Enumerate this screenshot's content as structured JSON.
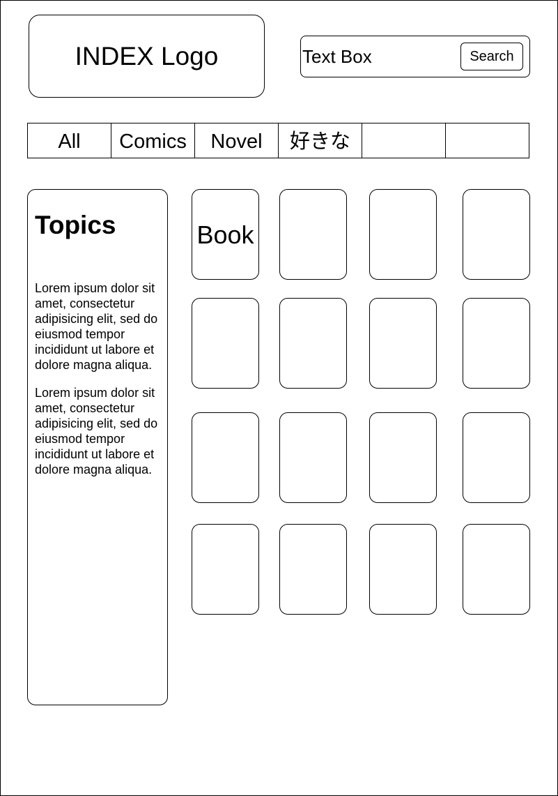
{
  "header": {
    "logo_text": "INDEX Logo",
    "search": {
      "value": "Text Box",
      "button_label": "Search"
    }
  },
  "tabs": [
    "All",
    "Comics",
    "Novel",
    "好きな",
    "",
    ""
  ],
  "sidebar": {
    "title": "Topics",
    "paragraphs": [
      "Lorem ipsum dolor sit amet, consectetur adipisicing elit, sed do eiusmod tempor incididunt ut labore et dolore magna aliqua.",
      "Lorem ipsum dolor sit amet, consectetur adipisicing elit, sed do eiusmod tempor incididunt ut labore et dolore magna aliqua."
    ]
  },
  "grid": {
    "rows": 4,
    "columns": 4,
    "cards": [
      "Book",
      "",
      "",
      "",
      "",
      "",
      "",
      "",
      "",
      "",
      "",
      "",
      "",
      "",
      "",
      ""
    ]
  }
}
